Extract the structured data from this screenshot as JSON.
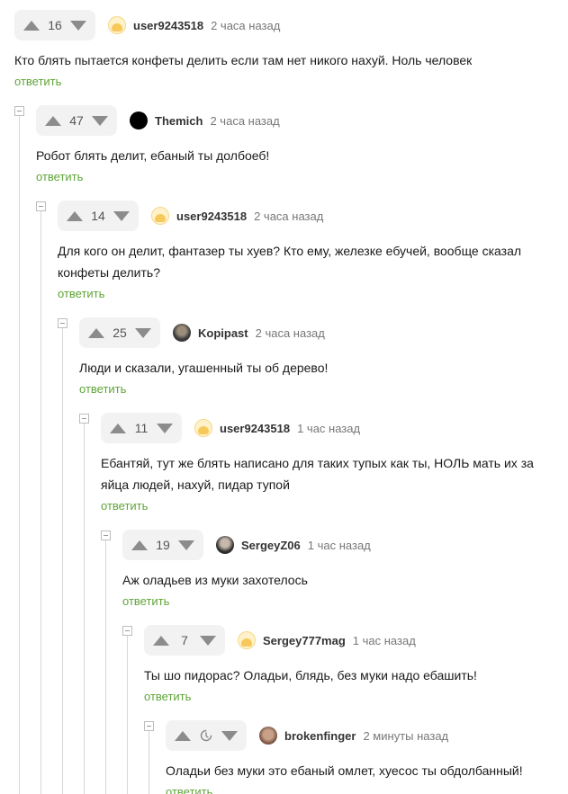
{
  "comments": [
    {
      "rating": "16",
      "user": "user9243518",
      "time": "2 часа назад",
      "text": "Кто блять пытается конфеты делить если там нет никого нахуй. Ноль человек",
      "reply": "ответить"
    },
    {
      "rating": "47",
      "user": "Themich",
      "time": "2 часа назад",
      "text": "Робот блять делит, ебаный ты долбоеб!",
      "reply": "ответить"
    },
    {
      "rating": "14",
      "user": "user9243518",
      "time": "2 часа назад",
      "text": "Для кого он делит, фантазер ты хуев? Кто ему, железке ебучей, вообще сказал конфеты делить?",
      "reply": "ответить"
    },
    {
      "rating": "25",
      "user": "Kopipast",
      "time": "2 часа назад",
      "text": "Люди и сказали, угашенный ты об дерево!",
      "reply": "ответить"
    },
    {
      "rating": "11",
      "user": "user9243518",
      "time": "1 час назад",
      "text": "Ебантяй, тут же блять написано для таких тупых как ты, НОЛЬ мать их за яйца людей, нахуй, пидар тупой",
      "reply": "ответить"
    },
    {
      "rating": "19",
      "user": "SergeyZ06",
      "time": "1 час назад",
      "text": "Аж оладьев из муки захотелось",
      "reply": "ответить"
    },
    {
      "rating": "7",
      "user": "Sergey777mag",
      "time": "1 час назад",
      "text": "Ты шо пидорас? Оладьи, блядь, без муки надо ебашить!",
      "reply": "ответить"
    },
    {
      "rating": "",
      "user": "brokenfinger",
      "time": "2 минуты назад",
      "text": "Оладьи без муки это ебаный омлет, хуесос ты обдолбанный!",
      "reply": "ответить"
    }
  ],
  "colors": {
    "accent": "#5fa538",
    "vote_bg": "#f2f2f2",
    "arrow": "#8c8c8c"
  }
}
